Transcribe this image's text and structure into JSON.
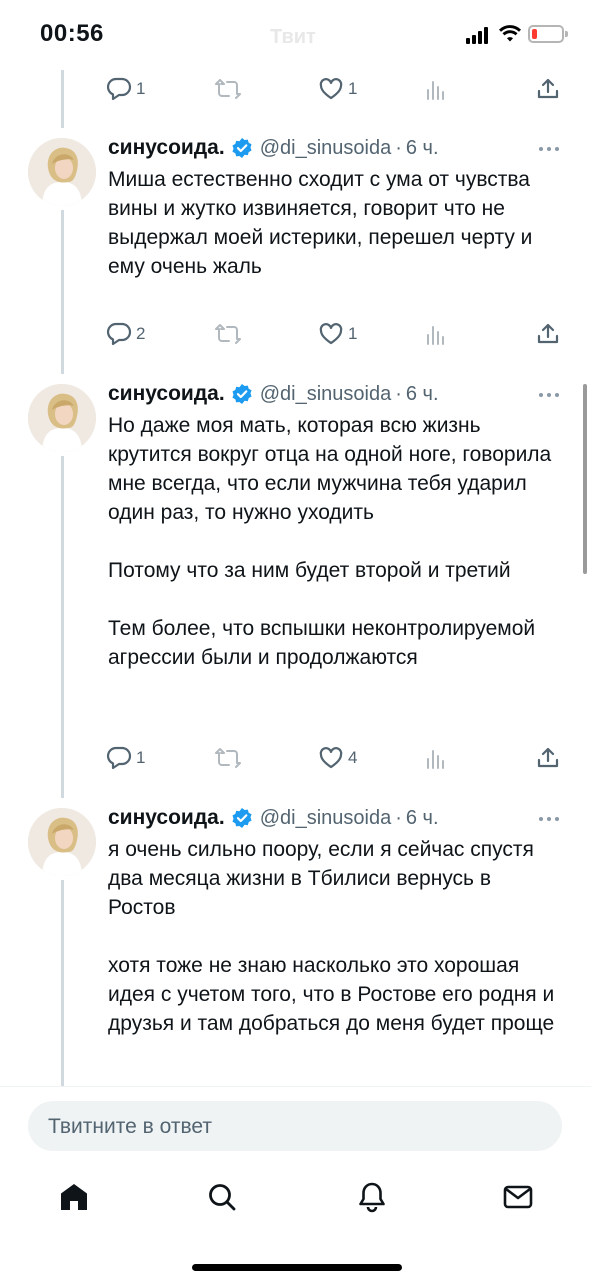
{
  "status_bar": {
    "time": "00:56",
    "ghost_title": "Твит",
    "battery_color": "#ff3b30"
  },
  "top_actions": {
    "reply_count": "1",
    "like_count": "1"
  },
  "tweets": [
    {
      "name": "синусоида.",
      "handle": "@di_sinusoida",
      "separator": "·",
      "time": "6 ч.",
      "paragraphs": [
        "Миша естественно сходит с ума от чувства вины и жутко извиняется, говорит что не выдержал моей истерики, перешел черту и ему очень жаль"
      ],
      "reply_count": "2",
      "like_count": "1"
    },
    {
      "name": "синусоида.",
      "handle": "@di_sinusoida",
      "separator": "·",
      "time": "6 ч.",
      "paragraphs": [
        "Но даже моя мать, которая всю жизнь крутится вокруг отца на одной ноге, говорила мне всегда, что если мужчина тебя ударил один раз, то нужно уходить",
        "Потому что за ним будет второй и третий",
        "Тем более, что вспышки неконтролируемой агрессии были и продолжаются"
      ],
      "reply_count": "1",
      "like_count": "4"
    },
    {
      "name": "синусоида.",
      "handle": "@di_sinusoida",
      "separator": "·",
      "time": "6 ч.",
      "paragraphs": [
        "я очень сильно поору, если я сейчас спустя два месяца жизни в Тбилиси вернусь в Ростов",
        "хотя тоже не знаю насколько это хорошая идея с учетом того, что в Ростове его родня и друзья и там добраться до меня будет проще"
      ]
    }
  ],
  "reply_input": {
    "placeholder": "Твитните в ответ"
  },
  "nav": [
    "home-icon",
    "search-icon",
    "notifications-icon",
    "messages-icon"
  ],
  "colors": {
    "text": "#0f1419",
    "secondary": "#536471",
    "verified": "#1d9bf0",
    "thread_line": "#cfd9de"
  }
}
